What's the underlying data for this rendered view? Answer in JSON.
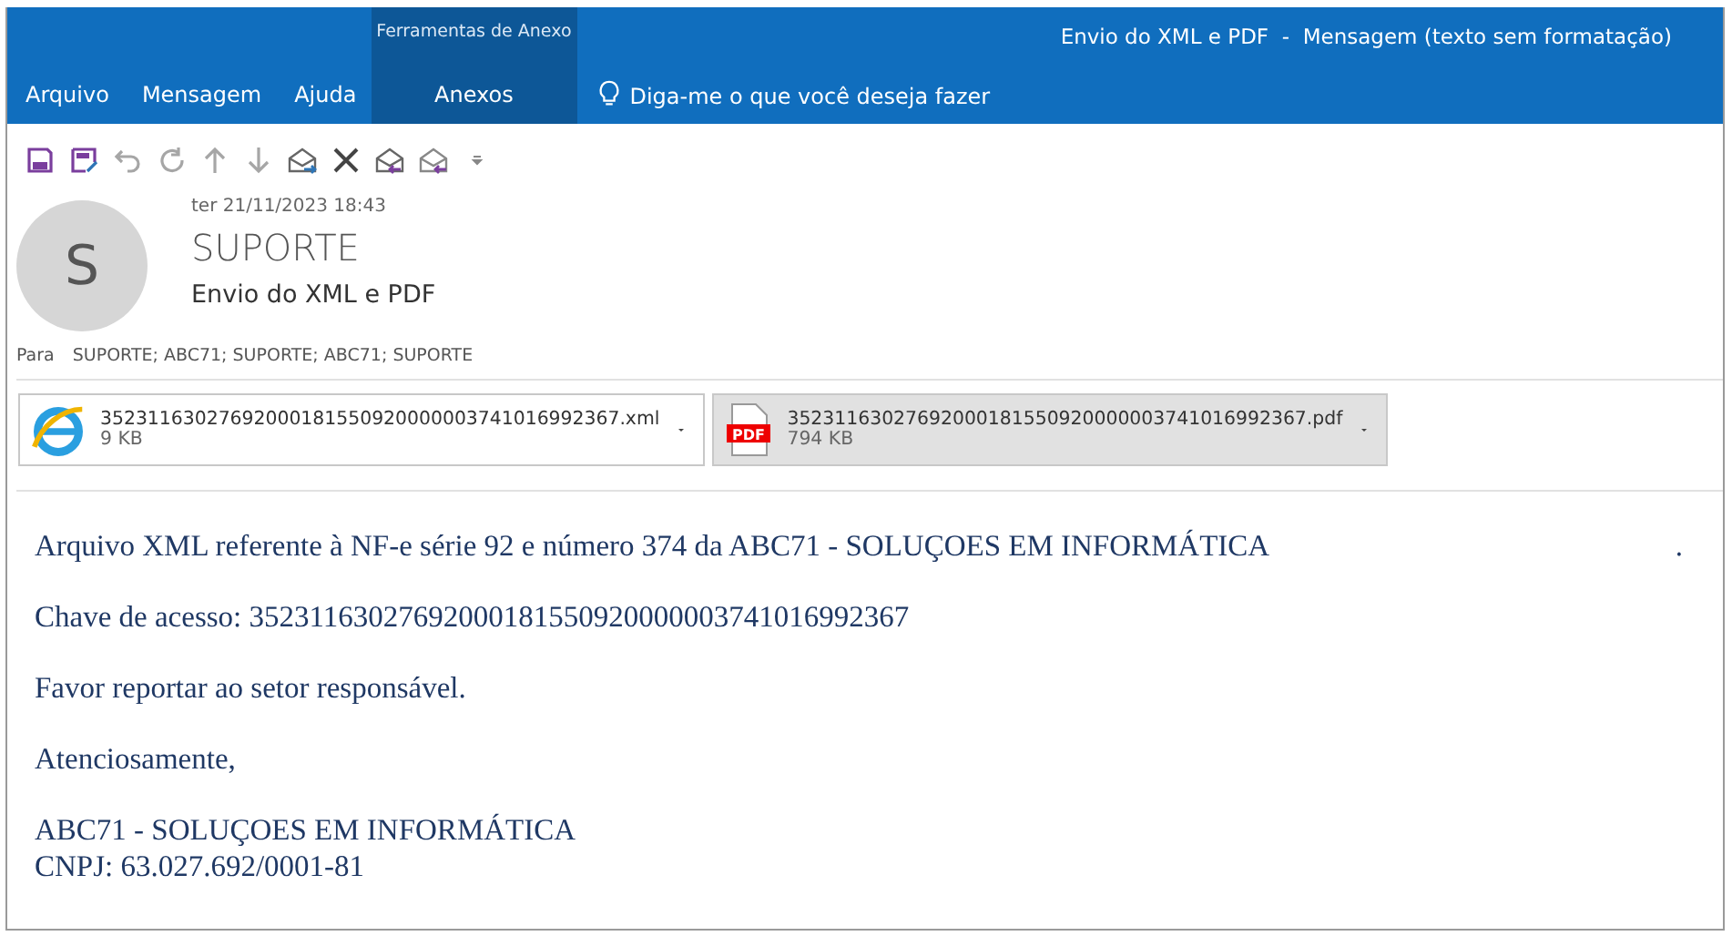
{
  "ribbon": {
    "context_group": "Ferramentas de Anexo",
    "window_title": "Envio do XML e PDF  -  Mensagem (texto sem formatação)",
    "tabs": [
      {
        "label": "Arquivo",
        "selected": false
      },
      {
        "label": "Mensagem",
        "selected": false
      },
      {
        "label": "Ajuda",
        "selected": false
      },
      {
        "label": "Anexos",
        "selected": true
      }
    ],
    "tell_me": "Diga-me o que você deseja fazer"
  },
  "header": {
    "avatar_letter": "S",
    "date": "ter 21/11/2023 18:43",
    "sender": "SUPORTE",
    "subject": "Envio do XML e PDF",
    "to_label": "Para",
    "to": "SUPORTE; ABC71; SUPORTE; ABC71; SUPORTE"
  },
  "attachments": [
    {
      "kind": "xml",
      "name": "35231163027692000181550920000003741016992367.xml",
      "size": "9 KB",
      "selected": false
    },
    {
      "kind": "pdf",
      "badge": "PDF",
      "name": "35231163027692000181550920000003741016992367.pdf",
      "size": "794 KB",
      "selected": true
    }
  ],
  "body": {
    "paragraphs": [
      [
        "Arquivo XML referente à NF-e série 92 e número 374 da ABC71 - SOLUÇOES EM INFORMÁTICA"
      ],
      [
        "Chave de acesso: 35231163027692000181550920000003741016992367"
      ],
      [
        "Favor reportar ao setor responsável."
      ],
      [
        "Atenciosamente,"
      ],
      [
        "ABC71 - SOLUÇOES EM INFORMÁTICA",
        "CNPJ: 63.027.692/0001-81"
      ]
    ],
    "trailing_mark": "."
  }
}
